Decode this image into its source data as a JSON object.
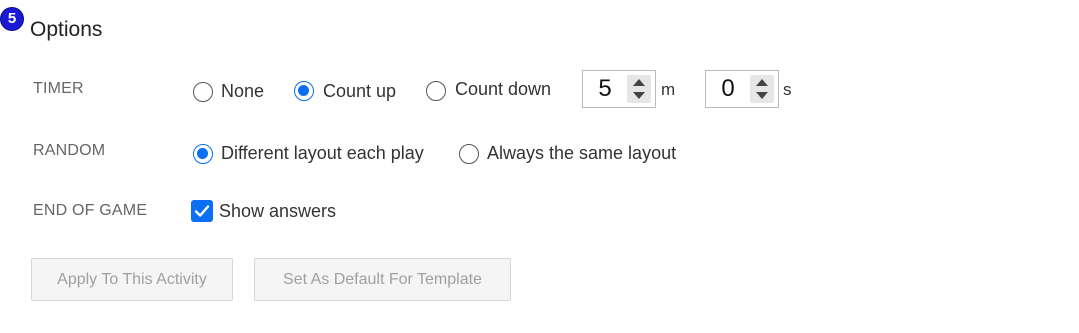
{
  "step_number": "5",
  "section_title": "Options",
  "timer": {
    "label": "TIMER",
    "options": [
      "None",
      "Count up",
      "Count down"
    ],
    "selected": "Count up",
    "minutes": {
      "value": "5",
      "unit": "m"
    },
    "seconds": {
      "value": "0",
      "unit": "s"
    }
  },
  "random": {
    "label": "RANDOM",
    "options": [
      "Different layout each play",
      "Always the same layout"
    ],
    "selected": "Different layout each play"
  },
  "end_of_game": {
    "label": "END OF GAME",
    "checkbox_label": "Show answers",
    "checked": true
  },
  "buttons": {
    "apply": "Apply To This Activity",
    "set_default": "Set As Default For Template"
  },
  "colors": {
    "accent": "#0a6ff2",
    "badge": "#1a1ad6"
  }
}
